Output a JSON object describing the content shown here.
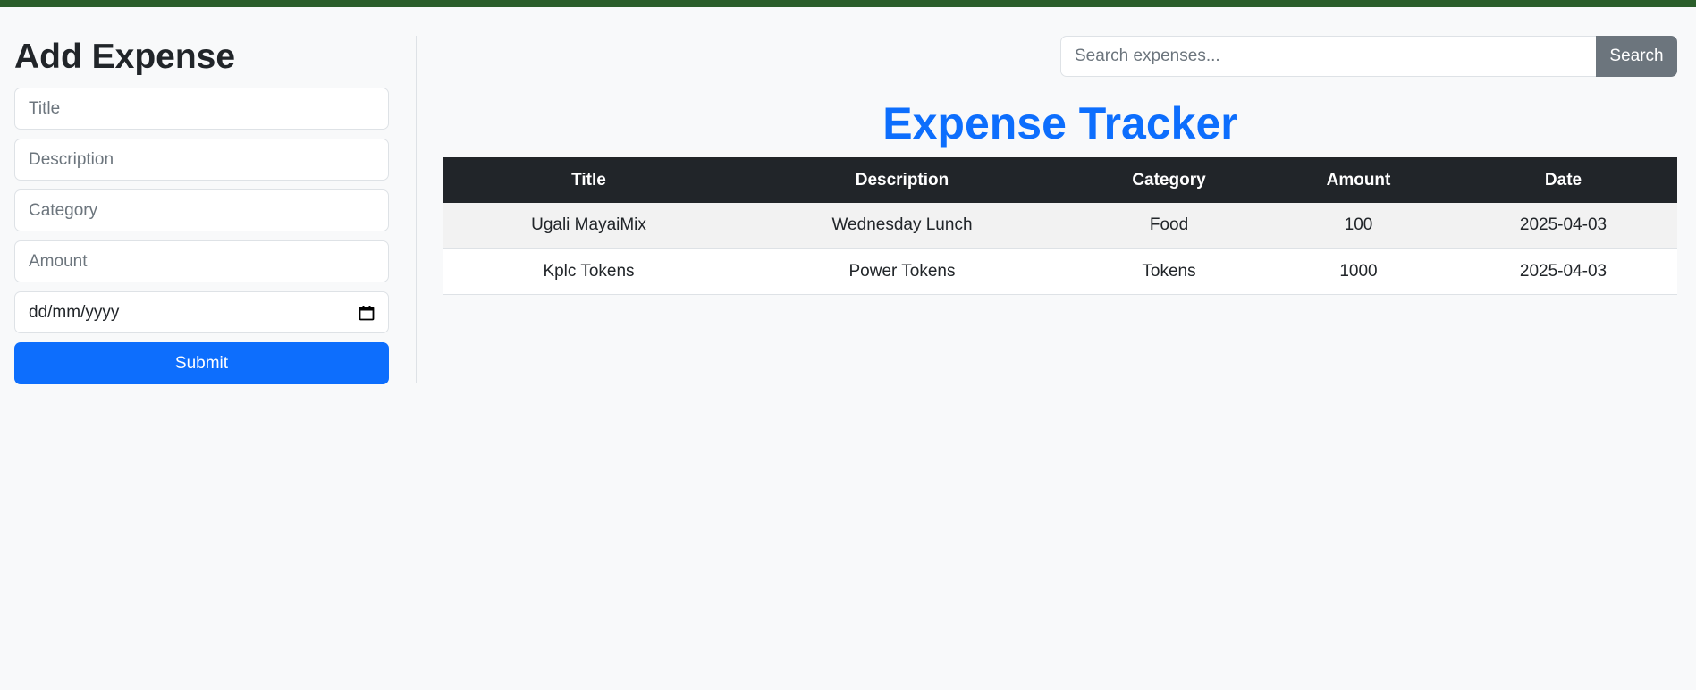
{
  "form": {
    "heading": "Add Expense",
    "title_placeholder": "Title",
    "description_placeholder": "Description",
    "category_placeholder": "Category",
    "amount_placeholder": "Amount",
    "date_placeholder": "dd/mm/yyyy",
    "submit_label": "Submit"
  },
  "search": {
    "placeholder": "Search expenses...",
    "button_label": "Search"
  },
  "main": {
    "title": "Expense Tracker"
  },
  "table": {
    "headers": [
      "Title",
      "Description",
      "Category",
      "Amount",
      "Date"
    ],
    "rows": [
      [
        "Ugali MayaiMix",
        "Wednesday Lunch",
        "Food",
        "100",
        "2025-04-03"
      ],
      [
        "Kplc Tokens",
        "Power Tokens",
        "Tokens",
        "1000",
        "2025-04-03"
      ]
    ]
  },
  "colors": {
    "top_bar": "#2b5e2b",
    "primary": "#0d6efd",
    "secondary": "#6c757d",
    "table_header": "#212529"
  },
  "icons": {
    "date_picker": "calendar-icon"
  }
}
